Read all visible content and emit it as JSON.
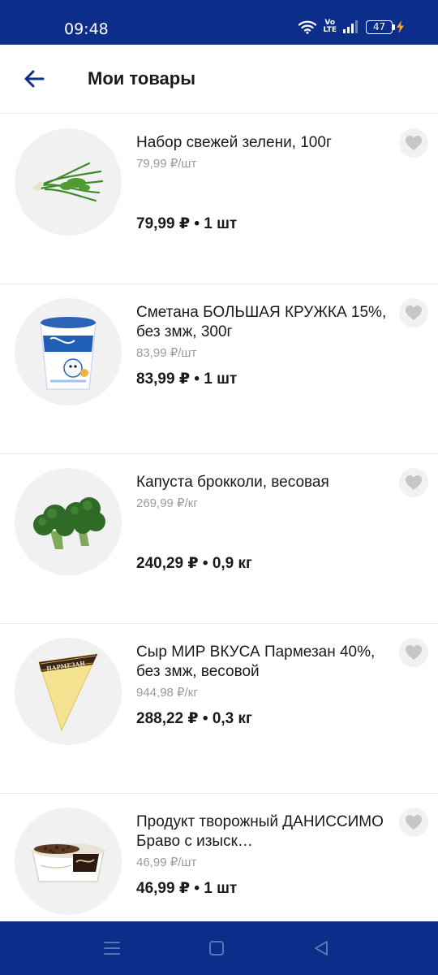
{
  "status_bar": {
    "time": "09:48",
    "battery": "47",
    "volte_top": "Vo",
    "volte_bottom": "LTE"
  },
  "header": {
    "title": "Мои товары"
  },
  "colors": {
    "brand_blue": "#0c2e8a",
    "divider": "#ececec",
    "muted_text": "#9a9a9a",
    "chip_bg": "#f1f1f1",
    "heart": "#c6c6c6"
  },
  "products": [
    {
      "name": "Набор свежей зелени, 100г",
      "unit_price": "79,99 ₽/шт",
      "total": "79,99 ₽ • 1 шт",
      "image": "green-onion-image"
    },
    {
      "name": "Сметана БОЛЬШАЯ КРУЖКА 15%, без змж, 300г",
      "unit_price": "83,99 ₽/шт",
      "total": "83,99 ₽ • 1 шт",
      "image": "sour-cream-cup-image"
    },
    {
      "name": "Капуста брокколи, весовая",
      "unit_price": "269,99 ₽/кг",
      "total": "240,29 ₽ • 0,9 кг",
      "image": "broccoli-image"
    },
    {
      "name": "Сыр МИР ВКУСА Пармезан 40%, без змж, весовой",
      "unit_price": "944,98 ₽/кг",
      "total": "288,22 ₽ • 0,3 кг",
      "image": "parmesan-cheese-image",
      "label": "ПАРМЕЗАН"
    },
    {
      "name": "Продукт творожный ДАНИССИМО Браво с изыск…",
      "unit_price": "46,99 ₽/шт",
      "total": "46,99 ₽ • 1 шт",
      "image": "danissimo-dessert-image"
    }
  ],
  "icons": {
    "back": "arrow-left-icon",
    "favorite": "heart-icon",
    "nav_menu": "menu-icon",
    "nav_home": "square-icon",
    "nav_back": "triangle-back-icon"
  }
}
